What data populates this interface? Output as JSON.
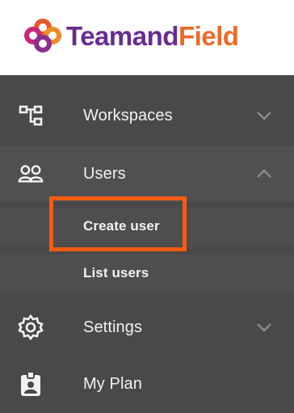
{
  "brand": {
    "name_part1": "Teamand",
    "name_part2": "Field",
    "colors": {
      "purple": "#6a2c8f",
      "orange": "#ee6a2a",
      "magenta": "#c9287a"
    }
  },
  "nav": {
    "items": [
      {
        "label": "Workspaces",
        "icon": "sitemap-icon",
        "expanded": false
      },
      {
        "label": "Users",
        "icon": "users-icon",
        "expanded": true,
        "children": [
          {
            "label": "Create user",
            "highlighted": true
          },
          {
            "label": "List users",
            "highlighted": false
          }
        ]
      },
      {
        "label": "Settings",
        "icon": "gear-icon",
        "expanded": false
      },
      {
        "label": "My Plan",
        "icon": "id-badge-icon"
      }
    ]
  },
  "colors": {
    "sidebar_bg": "#494949",
    "text": "#f2f2f2",
    "highlight_border": "#ff5a12"
  }
}
